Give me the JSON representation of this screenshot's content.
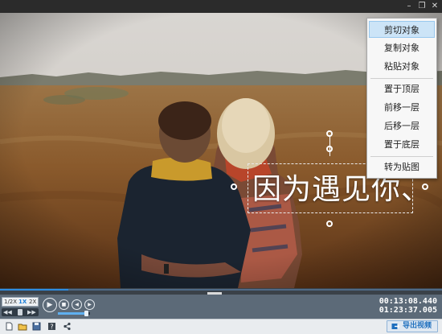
{
  "window": {
    "minimize_glyph": "–",
    "restore_glyph": "❐",
    "close_glyph": "✕"
  },
  "video": {
    "caption_text": "因为遇见你、"
  },
  "context_menu": {
    "items": [
      "剪切对象",
      "复制对象",
      "粘贴对象",
      "置于顶层",
      "前移一层",
      "后移一层",
      "置于底层",
      "转为贴图"
    ],
    "highlighted": "剪切对象"
  },
  "timeline": {
    "played_fraction": 0.155
  },
  "playback": {
    "speed_options": [
      "1/2X",
      "1X",
      "2X"
    ],
    "selected_speed": "1X",
    "rewind_glyph": "◀◀",
    "forward_glyph": "▶▶",
    "play_glyph": "▶",
    "stop_glyph": "■",
    "prev_glyph": "◀",
    "next_glyph": "▶",
    "current_time": "00:13:08.440",
    "total_time": "01:23:37.005",
    "volume_fraction": 0.88
  },
  "toolbar": {
    "export_label": "导出视频",
    "icons": [
      "new-file-icon",
      "open-folder-icon",
      "save-icon",
      "help-icon",
      "share-icon"
    ]
  },
  "colors": {
    "accent": "#2f8de0",
    "control_bar": "#5c6a78",
    "menu_highlight": "#cce4f7"
  }
}
